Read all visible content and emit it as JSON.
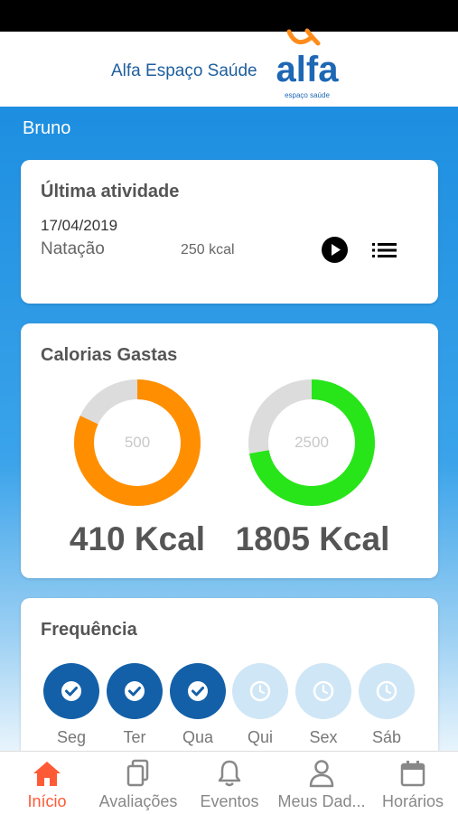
{
  "header": {
    "brand_text": "Alfa Espaço Saúde",
    "logo_word": "alfa",
    "logo_sub": "espaço saúde"
  },
  "user": {
    "name": "Bruno"
  },
  "last_activity": {
    "title": "Última atividade",
    "date": "17/04/2019",
    "name": "Natação",
    "kcal": "250 kcal",
    "play_icon": "play-icon",
    "list_icon": "list-icon"
  },
  "calories": {
    "title": "Calorias Gastas",
    "gauges": [
      {
        "goal": "500",
        "value": 410,
        "label": "410 Kcal",
        "color": "#ff8f00"
      },
      {
        "goal": "2500",
        "value": 1805,
        "label": "1805 Kcal",
        "color": "#27e519"
      }
    ]
  },
  "frequency": {
    "title": "Frequência",
    "days": [
      {
        "label": "Seg",
        "done": true
      },
      {
        "label": "Ter",
        "done": true
      },
      {
        "label": "Qua",
        "done": true
      },
      {
        "label": "Qui",
        "done": false
      },
      {
        "label": "Sex",
        "done": false
      },
      {
        "label": "Sáb",
        "done": false
      }
    ]
  },
  "tabs": [
    {
      "label": "Início",
      "icon": "home-icon",
      "active": true
    },
    {
      "label": "Avaliações",
      "icon": "documents-icon",
      "active": false
    },
    {
      "label": "Eventos",
      "icon": "bell-icon",
      "active": false
    },
    {
      "label": "Meus Dad...",
      "icon": "user-icon",
      "active": false
    },
    {
      "label": "Horários",
      "icon": "calendar-icon",
      "active": false
    }
  ],
  "colors": {
    "accent": "#1e8fe0",
    "tab_active": "#ff5a36",
    "done_day": "#1360a8",
    "pending_day": "#cfe6f6"
  }
}
